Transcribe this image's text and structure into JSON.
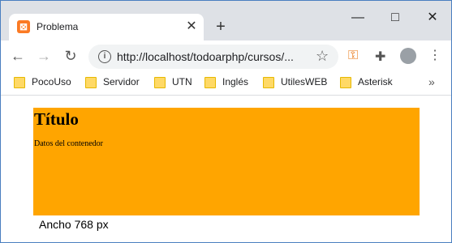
{
  "browser": {
    "tab": {
      "title": "Problema",
      "favicon": "xampp-icon"
    },
    "new_tab": "+",
    "window_controls": {
      "minimize": "—",
      "maximize": "□",
      "close": "✕"
    },
    "nav": {
      "back": "←",
      "forward": "→",
      "reload": "↻"
    },
    "address": {
      "url": "http://localhost/todoarphp/cursos/..."
    },
    "toolbar": {
      "star": "☆",
      "key": "🔑",
      "extensions": "🧩",
      "menu": "⋮"
    },
    "bookmarks": [
      "PocoUso",
      "Servidor",
      "UTN",
      "Inglés",
      "UtilesWEB",
      "Asterisk"
    ],
    "bookmarks_more": "»"
  },
  "page": {
    "heading": "Título",
    "content": "Datos del contenedor",
    "width_label": "Ancho 768 px",
    "container_color": "#ffa500"
  }
}
